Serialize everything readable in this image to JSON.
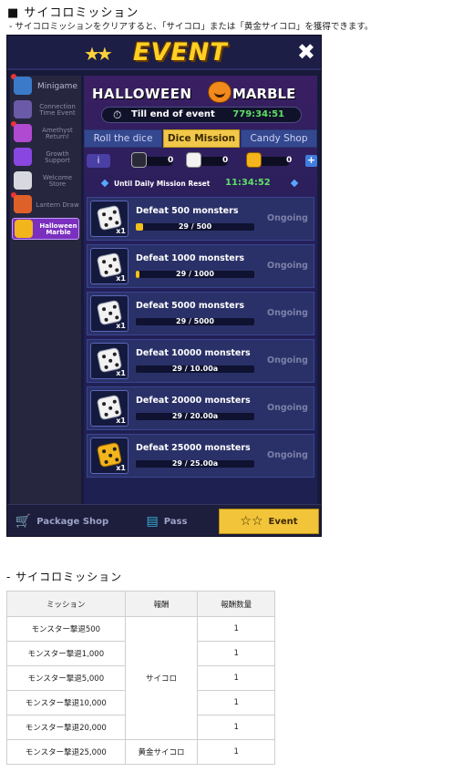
{
  "heading": "■ サイコロミッション",
  "subnote": "- サイコロミッションをクリアすると、「サイコロ」または「黄金サイコロ」を獲得できます。",
  "game": {
    "header": {
      "title": "EVENT",
      "close_icon": "✖"
    },
    "sidebar": [
      {
        "label": "Minigame",
        "icon": "gamepad-icon"
      },
      {
        "label": "Connection Time Event",
        "icon": "clock-icon"
      },
      {
        "label": "Amethyst Return!",
        "icon": "amethyst-icon"
      },
      {
        "label": "Growth Support",
        "icon": "lightning-icon"
      },
      {
        "label": "Welcome Store",
        "icon": "skull-icon"
      },
      {
        "label": "Lantern Draw",
        "icon": "lantern-icon"
      },
      {
        "label": "Halloween Marble",
        "icon": "pumpkin-icon"
      }
    ],
    "event_title_left": "HALLOWEEN",
    "event_title_right": "MARBLE",
    "timer": {
      "label": "Till end of event",
      "value": "779:34:51"
    },
    "tabs": [
      "Roll the dice",
      "Dice Mission",
      "Candy Shop"
    ],
    "active_tab": "Dice Mission",
    "currency": {
      "info": "i",
      "values": [
        "0",
        "0",
        "0"
      ],
      "plus": "+"
    },
    "reset": {
      "label": "Until Daily Mission Reset",
      "value": "11:34:52"
    },
    "missions": [
      {
        "name": "Defeat 500 monsters",
        "progress": "29 / 500",
        "fraction": 0.058,
        "qty": "x1",
        "status": "Ongoing",
        "dice": "white"
      },
      {
        "name": "Defeat 1000 monsters",
        "progress": "29 / 1000",
        "fraction": 0.029,
        "qty": "x1",
        "status": "Ongoing",
        "dice": "white"
      },
      {
        "name": "Defeat 5000 monsters",
        "progress": "29 / 5000",
        "fraction": 0.0,
        "qty": "x1",
        "status": "Ongoing",
        "dice": "white"
      },
      {
        "name": "Defeat 10000 monsters",
        "progress": "29 / 10.00a",
        "fraction": 0.0,
        "qty": "x1",
        "status": "Ongoing",
        "dice": "white"
      },
      {
        "name": "Defeat 20000 monsters",
        "progress": "29 / 20.00a",
        "fraction": 0.0,
        "qty": "x1",
        "status": "Ongoing",
        "dice": "white"
      },
      {
        "name": "Defeat 25000 monsters",
        "progress": "29 / 25.00a",
        "fraction": 0.0,
        "qty": "x1",
        "status": "Ongoing",
        "dice": "gold"
      }
    ],
    "bottom_nav": [
      {
        "label": "Package Shop",
        "icon": "cart-icon"
      },
      {
        "label": "Pass",
        "icon": "pass-icon"
      },
      {
        "label": "Event",
        "icon": "stars-icon"
      }
    ]
  },
  "section2_title": "- サイコロミッション",
  "table": {
    "headers": [
      "ミッション",
      "報酬",
      "報酬数量"
    ],
    "rows": [
      {
        "mission": "モンスター撃退500",
        "reward": "",
        "qty": "1"
      },
      {
        "mission": "モンスター撃退1,000",
        "reward": "",
        "qty": "1"
      },
      {
        "mission": "モンスター撃退5,000",
        "reward": "サイコロ",
        "qty": "1"
      },
      {
        "mission": "モンスター撃退10,000",
        "reward": "",
        "qty": "1"
      },
      {
        "mission": "モンスター撃退20,000",
        "reward": "",
        "qty": "1"
      },
      {
        "mission": "モンスター撃退25,000",
        "reward": "黄金サイコロ",
        "qty": "1"
      }
    ],
    "merged_reward": "サイコロ"
  }
}
